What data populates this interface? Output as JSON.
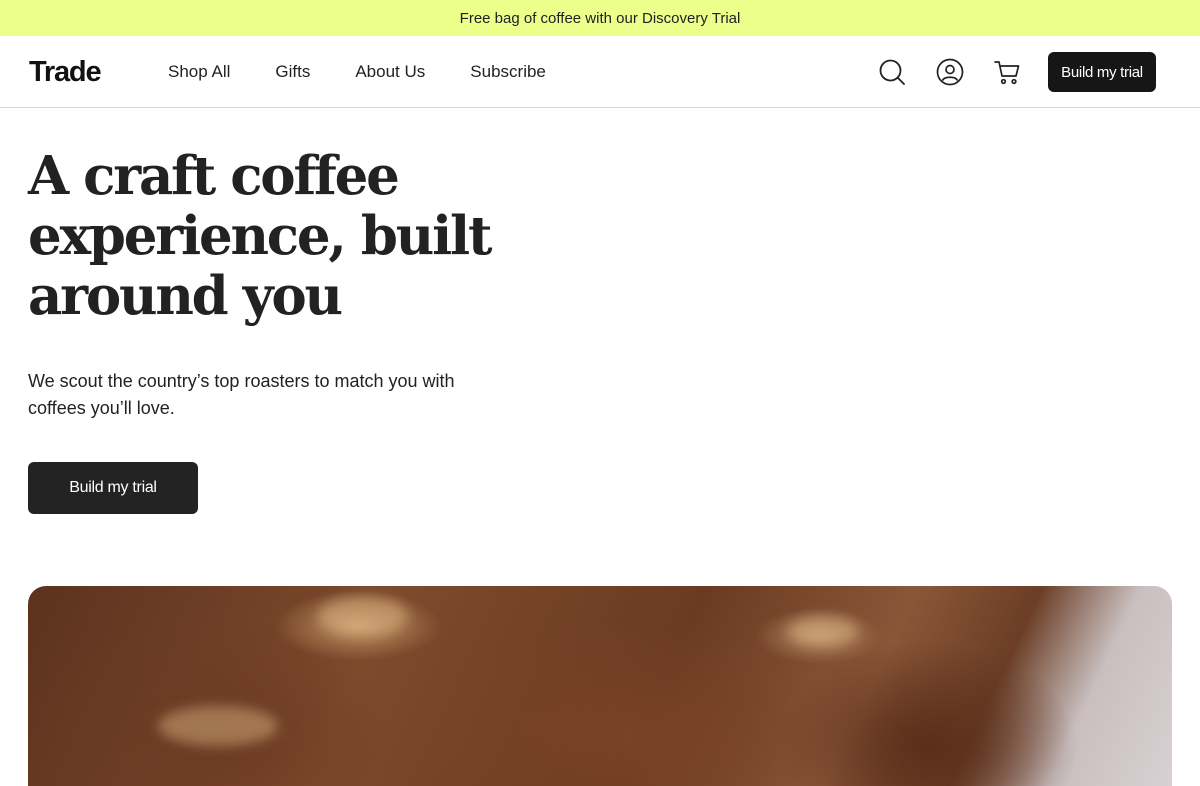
{
  "announcement": {
    "text": "Free bag of coffee with our Discovery Trial"
  },
  "header": {
    "logo": "Trade",
    "nav": [
      {
        "label": "Shop All"
      },
      {
        "label": "Gifts"
      },
      {
        "label": "About Us"
      },
      {
        "label": "Subscribe"
      }
    ],
    "icons": {
      "search": "search-icon",
      "account": "account-icon",
      "cart": "cart-icon"
    },
    "cta_label": "Build my trial"
  },
  "hero": {
    "title": "A craft coffee experience, built around you",
    "subtitle": "We scout the country’s top roasters to match you with coffees you’ll love.",
    "cta_label": "Build my trial"
  },
  "colors": {
    "announcement_bg": "#ecff8b",
    "button_bg": "#161616",
    "text": "#222222"
  }
}
